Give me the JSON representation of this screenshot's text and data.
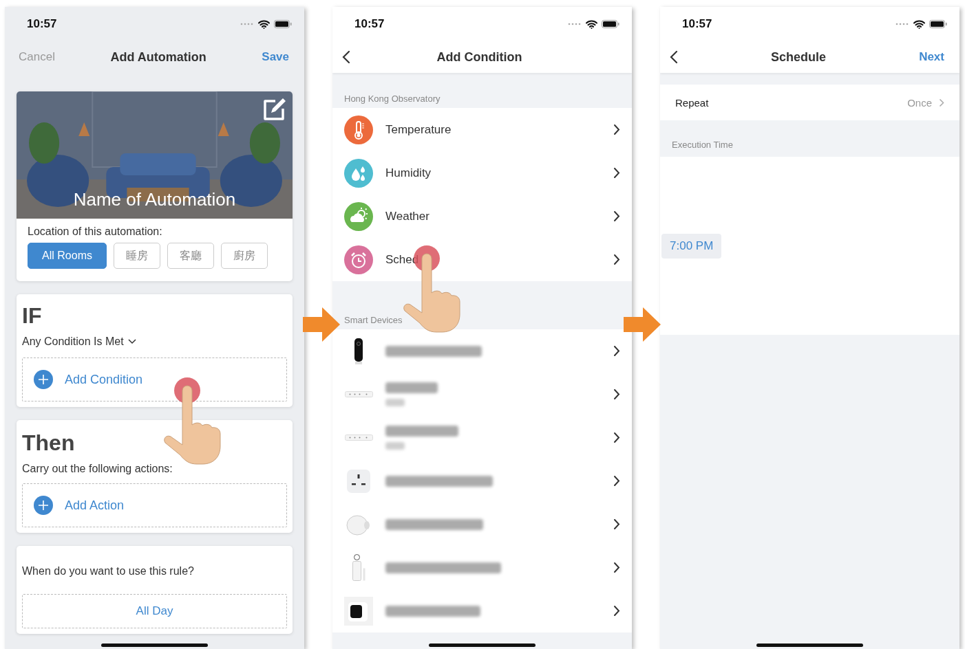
{
  "automation_screen": {
    "time": "10:57",
    "nav": {
      "left": "Cancel",
      "title": "Add Automation",
      "right": "Save"
    },
    "cover": {
      "kind": "picture",
      "title": "Name of Automation"
    },
    "location_label": "Location of this automation:",
    "rooms": [
      {
        "label": "All Rooms",
        "selected": true
      },
      {
        "label": "睡房",
        "selected": false
      },
      {
        "label": "客廳",
        "selected": false
      },
      {
        "label": "廚房",
        "selected": false
      }
    ],
    "if_section": {
      "heading": "IF",
      "match": "Any Condition Is Met",
      "add": "Add Condition"
    },
    "then_section": {
      "heading": "Then",
      "subtitle": "Carry out the following actions:",
      "add": "Add Action"
    },
    "when_section": {
      "question": "When do you want to use this rule?",
      "value": "All Day"
    }
  },
  "condition_screen": {
    "time": "10:57",
    "title": "Add Condition",
    "observatory": {
      "header": "Hong Kong Observatory",
      "items": [
        {
          "label": "Temperature",
          "kind": "thermometer",
          "color": "#ec6a3c"
        },
        {
          "label": "Humidity",
          "kind": "drops",
          "color": "#4fbdd0"
        },
        {
          "label": "Weather",
          "kind": "cloud",
          "color": "#6ab64f"
        },
        {
          "label": "Sched",
          "kind": "alarm",
          "color": "#d9719b"
        }
      ]
    },
    "devices": {
      "header": "Smart Devices",
      "rows": [
        {
          "kind": "camera",
          "two_line": false
        },
        {
          "kind": "power-strip",
          "two_line": true
        },
        {
          "kind": "power-strip",
          "two_line": true
        },
        {
          "kind": "plug",
          "two_line": false
        },
        {
          "kind": "motion-sensor",
          "two_line": false
        },
        {
          "kind": "door-sensor",
          "two_line": false
        },
        {
          "kind": "air-monitor",
          "two_line": false
        }
      ]
    }
  },
  "schedule_screen": {
    "time": "10:57",
    "title": "Schedule",
    "right": "Next",
    "repeat": {
      "label": "Repeat",
      "value": "Once"
    },
    "section": "Execution Time",
    "selected_time": "7:00 PM"
  }
}
